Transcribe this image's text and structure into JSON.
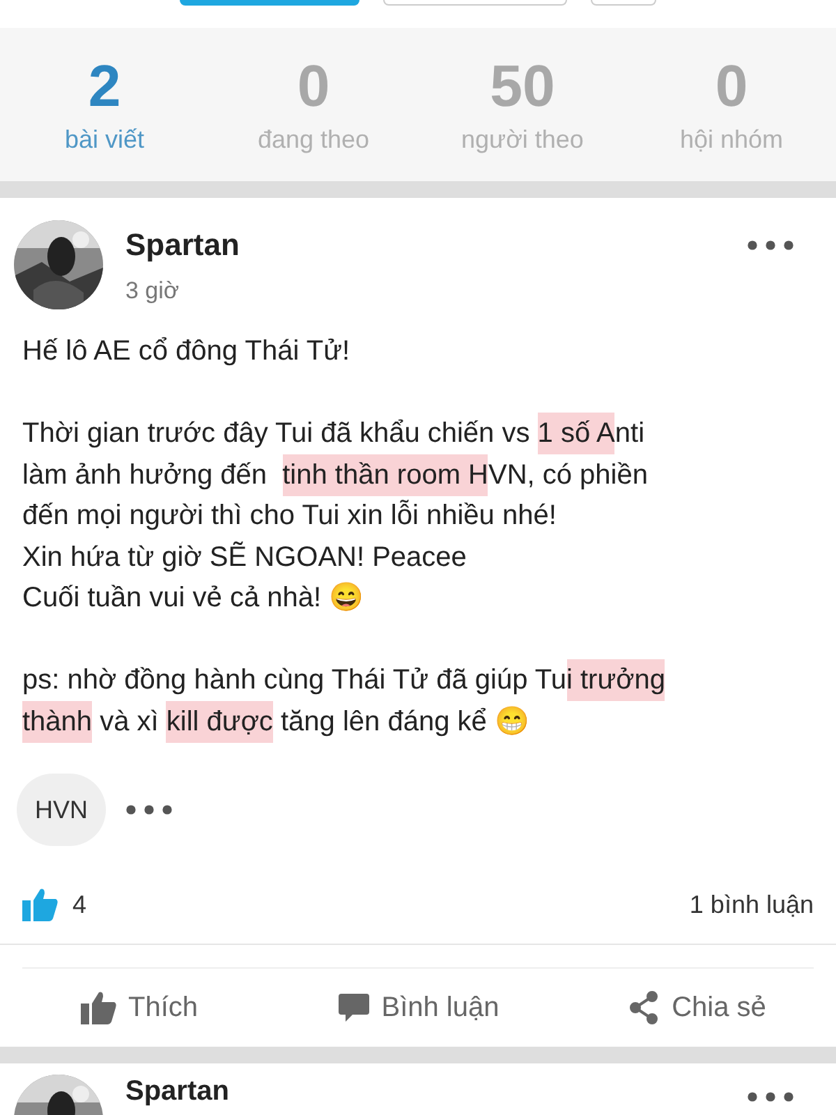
{
  "stats": [
    {
      "value": "2",
      "label": "bài viết",
      "selected": true
    },
    {
      "value": "0",
      "label": "đang theo",
      "selected": false
    },
    {
      "value": "50",
      "label": "người theo",
      "selected": false
    },
    {
      "value": "0",
      "label": "hội nhóm",
      "selected": false
    }
  ],
  "post": {
    "author": "Spartan",
    "time": "3 giờ",
    "lines": [
      [
        {
          "text": "Hế lô AE cổ đông Thái Tử!",
          "highlighted": false
        }
      ],
      [
        {
          "text": "Thời gian trước đây Tui đã khẩu chiến vs ",
          "highlighted": false
        },
        {
          "text": "1 số A",
          "highlighted": true
        },
        {
          "text": "nti",
          "highlighted": false
        }
      ],
      [
        {
          "text": "làm ảnh hưởng đến  ",
          "highlighted": false
        },
        {
          "text": "tinh thần room H",
          "highlighted": true
        },
        {
          "text": "VN, có phiền",
          "highlighted": false
        }
      ],
      [
        {
          "text": "đến mọi người thì cho Tui xin lỗi nhiều nhé!",
          "highlighted": false
        }
      ],
      [
        {
          "text": "Xin hứa từ giờ SẼ NGOAN! Peacee",
          "highlighted": false
        }
      ],
      [
        {
          "text": "Cuối tuần vui vẻ cả nhà! 😄",
          "highlighted": false
        }
      ],
      [
        {
          "text": "ps: nhờ đồng hành cùng Thái Tử đã giúp Tu",
          "highlighted": false
        },
        {
          "text": "i trưởng",
          "highlighted": true
        }
      ],
      [
        {
          "text": "thành",
          "highlighted": true
        },
        {
          "text": " và xì ",
          "highlighted": false
        },
        {
          "text": "kill được",
          "highlighted": true
        },
        {
          "text": " tăng lên đáng kể 😁",
          "highlighted": false
        }
      ]
    ],
    "tag": "HVN",
    "likes": "4",
    "comments": "1 bình luận",
    "actions": [
      {
        "kind": "like",
        "label": "Thích"
      },
      {
        "kind": "comment",
        "label": "Bình luận"
      },
      {
        "kind": "share",
        "label": "Chia sẻ"
      }
    ]
  },
  "next_post": {
    "author": "Spartan"
  }
}
